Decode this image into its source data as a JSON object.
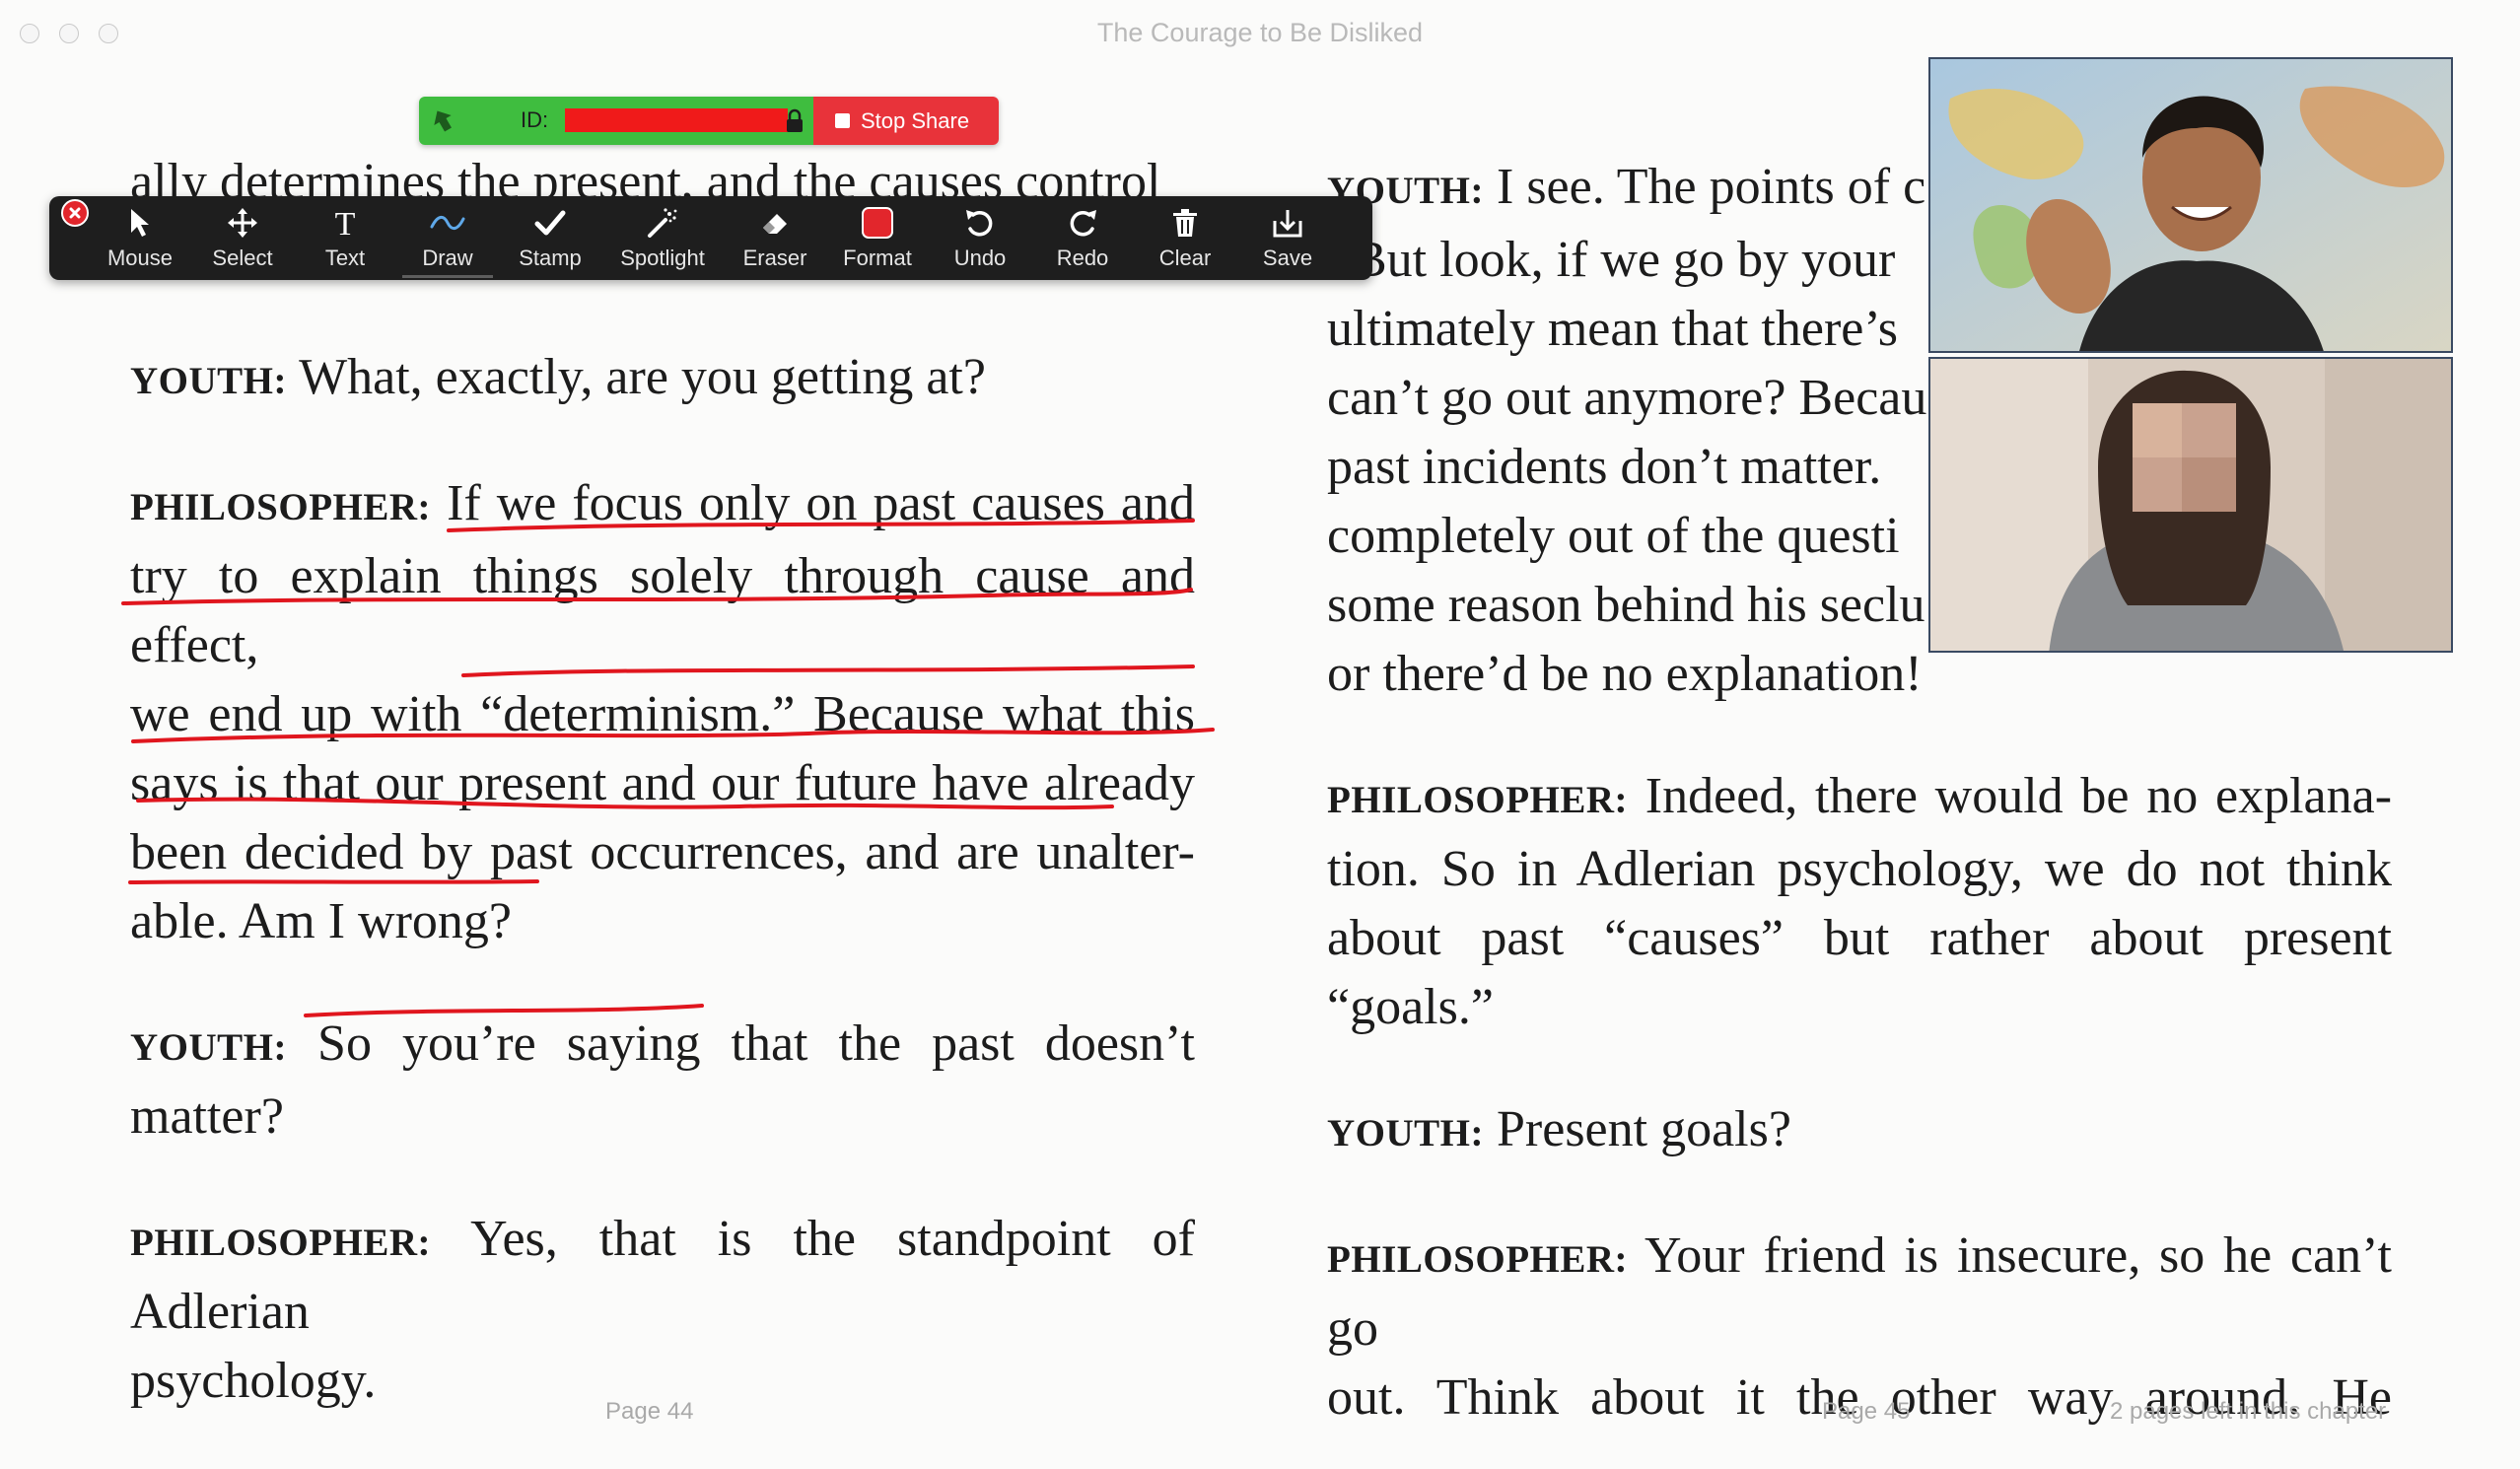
{
  "window": {
    "title": "The Courage to Be Disliked"
  },
  "share_bar": {
    "id_label": "ID:",
    "stop_label": "Stop Share"
  },
  "toolbar": {
    "tools": [
      {
        "label": "Mouse",
        "icon": "cursor-arrow-icon"
      },
      {
        "label": "Select",
        "icon": "move-arrows-icon"
      },
      {
        "label": "Text",
        "icon": "text-t-icon"
      },
      {
        "label": "Draw",
        "icon": "squiggle-icon"
      },
      {
        "label": "Stamp",
        "icon": "checkmark-icon"
      },
      {
        "label": "Spotlight",
        "icon": "magic-wand-icon"
      },
      {
        "label": "Eraser",
        "icon": "eraser-icon"
      },
      {
        "label": "Format",
        "icon": "red-square-icon"
      },
      {
        "label": "Undo",
        "icon": "undo-icon"
      },
      {
        "label": "Redo",
        "icon": "redo-icon"
      },
      {
        "label": "Clear",
        "icon": "trash-icon"
      },
      {
        "label": "Save",
        "icon": "save-download-icon"
      }
    ],
    "active_tool": "Draw",
    "accent": "#e2262c"
  },
  "left_page": {
    "top_line": "ally determines the present, and the causes control",
    "paragraphs": [
      {
        "speaker": "YOUTH:",
        "lines": [
          "What, exactly, are you getting at?"
        ]
      },
      {
        "speaker": "PHILOSOPHER:",
        "lines": [
          "If we focus only on past causes and",
          "try to explain things solely through cause and effect,",
          "we end up with “determinism.” Because what this",
          "says is that our present and our future have already",
          "been decided by past occurrences, and are unalter-",
          "able. Am I wrong?"
        ]
      },
      {
        "speaker": "YOUTH:",
        "lines": [
          "So you’re saying that the past doesn’t",
          "matter?"
        ]
      },
      {
        "speaker": "PHILOSOPHER:",
        "lines": [
          "Yes, that is the standpoint of Adlerian",
          "psychology."
        ]
      }
    ],
    "page_label": "Page 44"
  },
  "right_page": {
    "paragraphs": [
      {
        "speaker": "YOUTH:",
        "lines": [
          "I see. The points of c",
          ". But look, if we go by your",
          "ultimately mean that there’s",
          "can’t go out anymore? Becau",
          "past incidents don’t matter.",
          "completely out of the questi",
          "some reason behind his seclu",
          "or there’d be no explanation!"
        ]
      },
      {
        "speaker": "PHILOSOPHER:",
        "lines": [
          "Indeed, there would be no explana-",
          "tion. So in Adlerian psychology, we do not think",
          "about past “causes” but rather about present “goals.”"
        ]
      },
      {
        "speaker": "YOUTH:",
        "lines": [
          "Present goals?"
        ]
      },
      {
        "speaker": "PHILOSOPHER:",
        "lines": [
          "Your friend is insecure, so he can’t go",
          "out. Think about it the other way around. He"
        ]
      }
    ],
    "page_label": "Page 45",
    "chapter_note": "2 pages left in this chapter"
  },
  "video_tiles": [
    {
      "name": "participant-1"
    },
    {
      "name": "participant-2"
    }
  ],
  "annotation_color": "#e0161e"
}
